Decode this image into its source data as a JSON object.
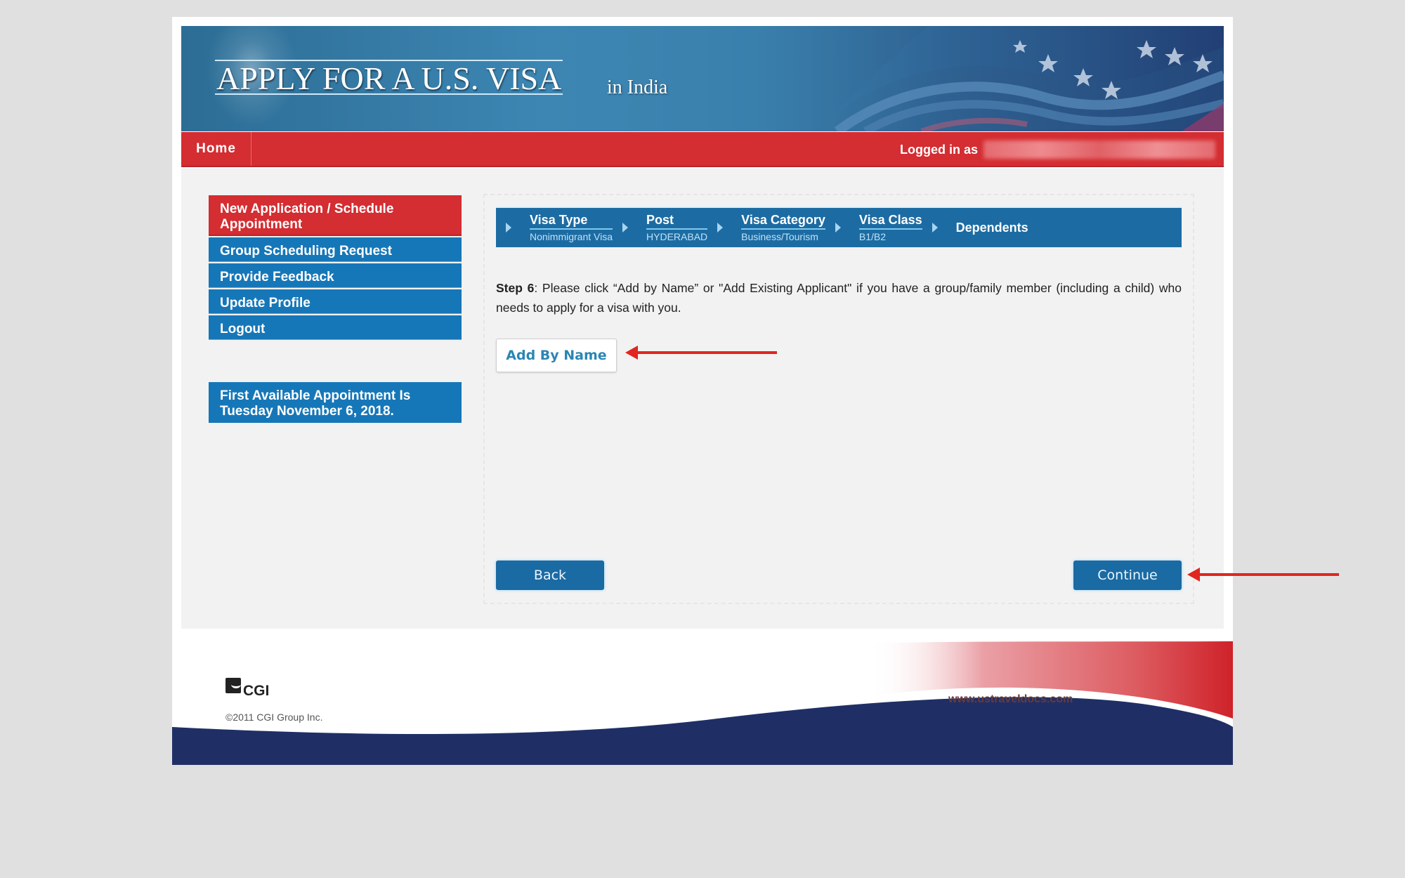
{
  "header": {
    "title": "APPLY FOR A U.S. VISA",
    "subtitle": "in India"
  },
  "navbar": {
    "home_label": "Home",
    "logged_in_label": "Logged in as",
    "logged_in_user": ""
  },
  "sidebar": {
    "items": [
      {
        "label": "New Application / Schedule Appointment",
        "active": true
      },
      {
        "label": "Group Scheduling Request",
        "active": false
      },
      {
        "label": "Provide Feedback",
        "active": false
      },
      {
        "label": "Update Profile",
        "active": false
      },
      {
        "label": "Logout",
        "active": false
      }
    ],
    "appointment_notice": "First Available Appointment Is Tuesday November 6, 2018."
  },
  "steps": [
    {
      "name": "Visa Type",
      "value": "Nonimmigrant Visa"
    },
    {
      "name": "Post",
      "value": "HYDERABAD"
    },
    {
      "name": "Visa Category",
      "value": "Business/Tourism"
    },
    {
      "name": "Visa Class",
      "value": "B1/B2"
    },
    {
      "name": "Dependents",
      "value": ""
    }
  ],
  "main": {
    "step_label": "Step 6",
    "instructions": ": Please click “Add by Name” or \"Add Existing Applicant\" if you have a group/family member (including a child) who needs to apply for a visa with you.",
    "add_by_name_label": "Add By Name",
    "back_label": "Back",
    "continue_label": "Continue"
  },
  "footer": {
    "logo_text": "CGI",
    "copyright": "©2011 CGI Group Inc.",
    "site_url": "www.ustraveldocs.com"
  },
  "colors": {
    "brand_red": "#d42d32",
    "brand_blue": "#1677b8",
    "step_bar_blue": "#1c6ca3",
    "button_blue": "#1a6aa3",
    "annotation_red": "#e0261f",
    "footer_navy": "#1f2f66"
  }
}
